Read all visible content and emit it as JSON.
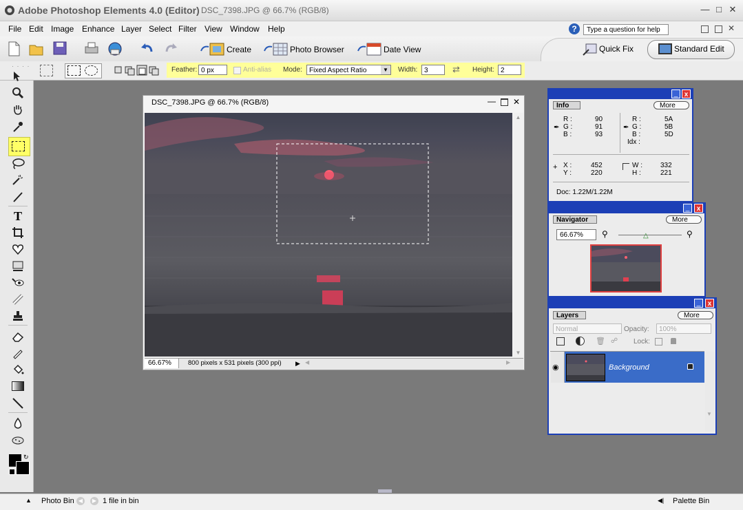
{
  "window": {
    "app_title": "Adobe Photoshop Elements 4.0 (Editor)",
    "doc_title": "DSC_7398.JPG @ 66.7% (RGB/8)"
  },
  "menu": [
    "File",
    "Edit",
    "Image",
    "Enhance",
    "Layer",
    "Select",
    "Filter",
    "View",
    "Window",
    "Help"
  ],
  "help": {
    "placeholder": "Type a question for help"
  },
  "shortcuts": {
    "create": "Create",
    "photo_browser": "Photo Browser",
    "date_view": "Date View",
    "quick_fix": "Quick Fix",
    "standard_edit": "Standard Edit"
  },
  "options": {
    "feather_label": "Feather:",
    "feather_value": "0 px",
    "anti_alias": "Anti-alias",
    "mode_label": "Mode:",
    "mode_value": "Fixed Aspect Ratio",
    "width_label": "Width:",
    "width_value": "3",
    "height_label": "Height:",
    "height_value": "2"
  },
  "document": {
    "title": "DSC_7398.JPG @ 66.7% (RGB/8)",
    "zoom": "66.67%",
    "status": "800 pixels x 531 pixels (300 ppi)"
  },
  "info": {
    "tab": "Info",
    "more": "More",
    "rgb1": {
      "r": "90",
      "g": "91",
      "b": "93"
    },
    "rgb2": {
      "r": "5A",
      "g": "5B",
      "b": "5D"
    },
    "idx_label": "Idx :",
    "x": "452",
    "y": "220",
    "w": "332",
    "h": "221",
    "doc": "Doc: 1.22M/1.22M"
  },
  "navigator": {
    "tab": "Navigator",
    "more": "More",
    "zoom": "66.67%"
  },
  "layers": {
    "tab": "Layers",
    "more": "More",
    "blend_mode": "Normal",
    "opacity_label": "Opacity:",
    "opacity_value": "100%",
    "lock_label": "Lock:",
    "layer_name": "Background"
  },
  "bottom": {
    "photo_bin": "Photo Bin",
    "file_count": "1 file in bin",
    "palette_bin": "Palette Bin"
  },
  "colors": {
    "palette_border": "#1c3fb6",
    "layer_selected": "#3a6cc8",
    "options_highlight": "#ffff99"
  }
}
